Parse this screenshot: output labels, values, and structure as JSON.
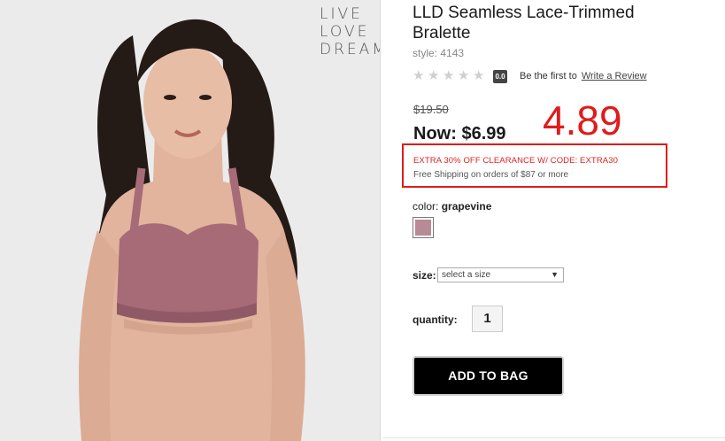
{
  "brand_logo": [
    "LIVE",
    "LOVE",
    "DREAM"
  ],
  "product": {
    "title": "LLD Seamless Lace-Trimmed Bralette",
    "style": "style: 4143",
    "rating": {
      "stars_filled": 0,
      "stars_total": 5,
      "badge": "0.0",
      "prompt": "Be the first to",
      "link": "Write a Review"
    }
  },
  "pricing": {
    "was": "$19.50",
    "now_label": "Now:",
    "now_value": "$6.99",
    "annotation": "4.89",
    "promo": "EXTRA 30% OFF CLEARANCE W/ CODE: EXTRA30",
    "shipping": "Free Shipping on orders of $87 or more"
  },
  "color": {
    "label": "color:",
    "value": "grapevine",
    "swatch_hex": "#b88a95"
  },
  "size": {
    "label": "size:",
    "selected": "select a size"
  },
  "quantity": {
    "label": "quantity:",
    "value": "1"
  },
  "actions": {
    "add_to_bag": "ADD TO BAG"
  },
  "colors": {
    "annotation_red": "#e01b1b",
    "promo_red": "#dd2222",
    "button_black": "#000000"
  }
}
